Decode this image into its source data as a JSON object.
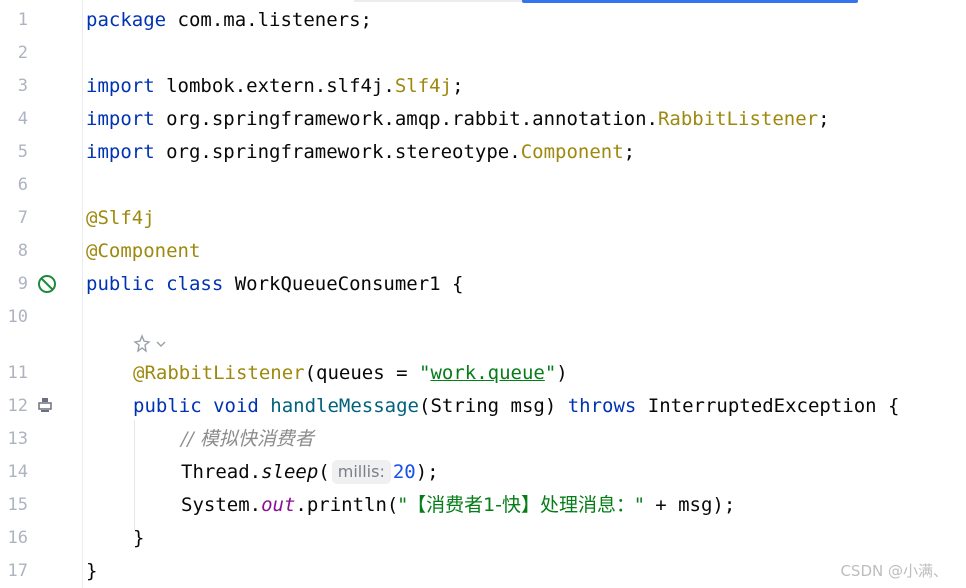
{
  "editor": {
    "line_numbers": [
      "1",
      "2",
      "3",
      "4",
      "5",
      "6",
      "7",
      "8",
      "9",
      "10",
      "11",
      "12",
      "13",
      "14",
      "15",
      "16",
      "17"
    ],
    "lines": {
      "l1_kw": "package",
      "l1_rest": " com.ma.listeners;",
      "l3_kw": "import",
      "l3_rest": " lombok.extern.slf4j.",
      "l3_cls": "Slf4j",
      "l3_end": ";",
      "l4_kw": "import",
      "l4_rest": " org.springframework.amqp.rabbit.annotation.",
      "l4_cls": "RabbitListener",
      "l4_end": ";",
      "l5_kw": "import",
      "l5_rest": " org.springframework.stereotype.",
      "l5_cls": "Component",
      "l5_end": ";",
      "l7_ann": "@Slf4j",
      "l8_ann": "@Component",
      "l9_kw": "public class",
      "l9_rest": " WorkQueueConsumer1 {",
      "l11_ann": "@RabbitListener",
      "l11_a": "(queues = ",
      "l11_q1": "\"",
      "l11_str": "work.queue",
      "l11_q2": "\"",
      "l11_b": ")",
      "l12_kw1": "public void",
      "l12_fn": " handleMessage",
      "l12_a": "(String msg) ",
      "l12_kw2": "throws",
      "l12_b": " InterruptedException {",
      "l13_cmt": "// 模拟快消费者",
      "l14_a": "Thread.",
      "l14_fn": "sleep",
      "l14_b": "(",
      "l14_hint": "millis:",
      "l14_num": "20",
      "l14_c": ");",
      "l15_a": "System.",
      "l15_out": "out",
      "l15_b": ".println(",
      "l15_str": "\"【消费者1-快】处理消息：\"",
      "l15_c": " + msg);",
      "l16": "}",
      "l17": "}"
    }
  },
  "watermark": "CSDN @小满、",
  "colors": {
    "keyword": "#0033b3",
    "annotation": "#9e880d",
    "string": "#067d17",
    "number": "#1750eb",
    "accent": "#3574f0"
  }
}
